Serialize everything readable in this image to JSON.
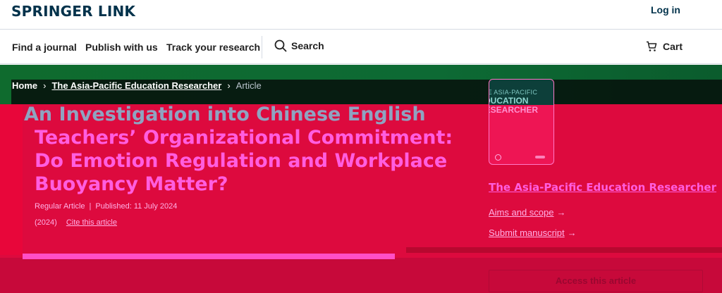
{
  "header": {
    "logo": "SPRINGER LINK",
    "login_label": "Log in"
  },
  "nav": {
    "items": [
      "Find a journal",
      "Publish with us",
      "Track your research"
    ],
    "search_label": "Search",
    "cart_label": "Cart"
  },
  "breadcrumb": {
    "home": "Home",
    "journal": "The Asia-Pacific Education Researcher",
    "current": "Article"
  },
  "article": {
    "title_line1": "An Investigation into Chinese English",
    "title_rest": "Teachers’ Organizational Commitment: Do Emotion Regulation and Workplace Buoyancy Matter?",
    "type": "Regular Article",
    "published": "Published: 11 July 2024",
    "year": "(2024)",
    "cite_label": "Cite this article"
  },
  "sidebar": {
    "cover": {
      "line1": "THE ASIA-PACIFIC",
      "line2": "EDUCATION",
      "line3": "RESEARCHER"
    },
    "journal_title": "The Asia-Pacific Education Researcher",
    "aims_label": "Aims and scope",
    "submit_label": "Submit manuscript",
    "access_label": "Access this article"
  },
  "colors": {
    "brand": "#01324b",
    "hero": "#dd0a3e",
    "hero_top": "#0f6b2e",
    "link_pink": "#ff5ee0"
  }
}
